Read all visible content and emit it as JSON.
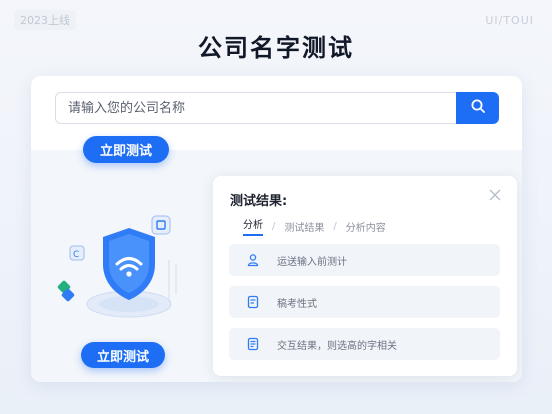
{
  "header": {
    "corner_tag": "2023上线",
    "corner_right": "UI/TOUI",
    "title": "公司名字测试"
  },
  "search": {
    "placeholder": "请输入您的公司名称",
    "button_icon": "search-icon"
  },
  "actions": {
    "primary_label": "立即测试",
    "secondary_label": "立即测试"
  },
  "result_panel": {
    "title": "测试结果:",
    "tabs": [
      {
        "label": "分析",
        "active": true
      },
      {
        "label": "测试结果",
        "active": false
      },
      {
        "label": "分析内容",
        "active": false
      }
    ],
    "rows": [
      {
        "icon": "user-icon",
        "text": "运送输入前测计"
      },
      {
        "icon": "document-icon",
        "text": "稿考性式"
      },
      {
        "icon": "note-icon",
        "text": "交互结果，则选高的字相关"
      }
    ]
  },
  "colors": {
    "accent": "#1d6ef5",
    "background": "#eef2f8",
    "panel_row": "#f1f4f9"
  }
}
